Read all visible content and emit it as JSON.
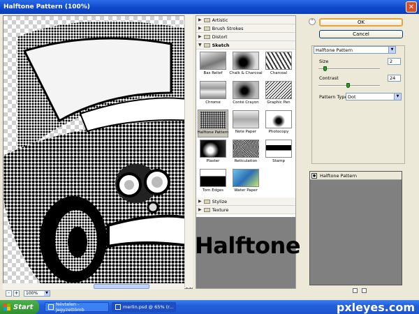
{
  "window": {
    "title": "Halftone Pattern (100%)",
    "close_glyph": "✕"
  },
  "preview": {
    "zoom": "100%",
    "zoom_minus": "-",
    "zoom_plus": "+",
    "dropdown_glyph": "▼"
  },
  "gallery": {
    "categories_top": [
      {
        "label": "Artistic",
        "state": "collapsed"
      },
      {
        "label": "Brush Strokes",
        "state": "collapsed"
      },
      {
        "label": "Distort",
        "state": "collapsed"
      },
      {
        "label": "Sketch",
        "state": "expanded"
      }
    ],
    "filters": [
      "Bas Relief",
      "Chalk & Charcoal",
      "Charcoal",
      "Chrome",
      "Conté Crayon",
      "Graphic Pen",
      "Halftone Pattern",
      "Note Paper",
      "Photocopy",
      "Plaster",
      "Reticulation",
      "Stamp",
      "Torn Edges",
      "Water Paper"
    ],
    "selected_filter": "Halftone Pattern",
    "categories_bottom": [
      {
        "label": "Stylize",
        "state": "collapsed"
      },
      {
        "label": "Texture",
        "state": "collapsed"
      }
    ]
  },
  "caption": "Halftone pattern",
  "buttons": {
    "ok": "OK",
    "cancel": "Cancel",
    "collapse_glyph": "⌃"
  },
  "settings": {
    "filter_select": "Halftone Pattern",
    "size_label": "Size",
    "size_value": "2",
    "contrast_label": "Contrast",
    "contrast_value": "24",
    "pattern_type_label": "Pattern Type:",
    "pattern_type_value": "Dot",
    "dropdown_glyph": "▼"
  },
  "layers": {
    "items": [
      "Halftone Pattern"
    ],
    "eye_glyph": "●"
  },
  "taskbar": {
    "start": "Start",
    "tasks": [
      "Névtelen - Jegyzettömb",
      "merlin.psd @ 65% (r..."
    ],
    "watermark": "pxleyes.com"
  },
  "colors": {
    "titlebar": "#0d47c9",
    "taskbar": "#245edb",
    "start": "#3c9b3c",
    "preview_gray": "#808080"
  },
  "slider_levels": {
    "size": 0.1,
    "contrast": 0.48
  }
}
